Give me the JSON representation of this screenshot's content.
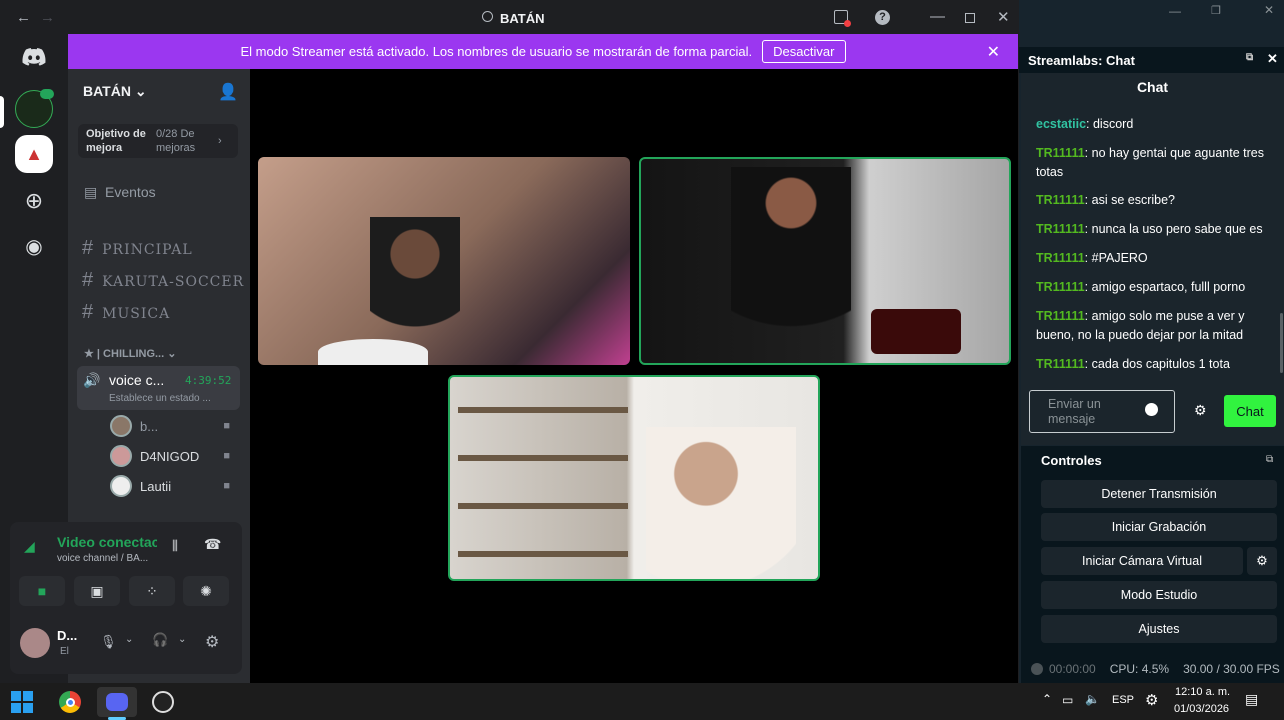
{
  "discord": {
    "window_title": "BATÁN",
    "banner": {
      "text": "El modo Streamer está activado. Los nombres de usuario se mostrarán de forma parcial.",
      "button": "Desactivar"
    },
    "server_name": "BATÁN",
    "boost": {
      "label": "Objetivo de mejora",
      "value": "0/28 De mejoras"
    },
    "events": "Eventos",
    "channels": [
      "PRINCIPAL",
      "KARUTA-SOCCER",
      "MUSICA"
    ],
    "category": "| CHILLING...",
    "voice_channel": {
      "name": "voice c...",
      "time": "4:39:52",
      "status": "Establece un estado ..."
    },
    "members": [
      "b...",
      "D4NIGOD",
      "Lautii"
    ],
    "voice_status": {
      "title": "Video conectac",
      "sub": "voice channel / BA..."
    },
    "user": {
      "name": "D...",
      "status": "El"
    }
  },
  "streamlabs": {
    "panel_title": "Streamlabs: Chat",
    "chat_title": "Chat",
    "messages": [
      {
        "user": "ecstatiic",
        "text": ": discord"
      },
      {
        "user": "TR11111",
        "text": ": no hay gentai que aguante tres totas"
      },
      {
        "user": "TR11111",
        "text": ": asi se escribe?"
      },
      {
        "user": "TR11111",
        "text": ": nunca la uso pero sabe que es"
      },
      {
        "user": "TR11111",
        "text": ": #PAJERO"
      },
      {
        "user": "TR11111",
        "text": ": amigo espartaco, fulll porno"
      },
      {
        "user": "TR11111",
        "text": ": amigo solo me puse a ver y bueno, no la puedo dejar por la mitad"
      },
      {
        "user": "TR11111",
        "text": ": cada dos capitulos 1 tota"
      }
    ],
    "input_placeholder": "Enviar un mensaje",
    "send_button": "Chat",
    "controls_title": "Controles",
    "controls": [
      "Detener Transmisión",
      "Iniciar Grabación",
      "Iniciar Cámara Virtual",
      "Modo Estudio",
      "Ajustes"
    ],
    "status": {
      "time": "00:00:00",
      "cpu": "CPU: 4.5%",
      "fps": "30.00 / 30.00 FPS"
    }
  },
  "taskbar": {
    "lang": "ESP",
    "time": "12:10 a. m.",
    "date": "01/03/2026"
  }
}
